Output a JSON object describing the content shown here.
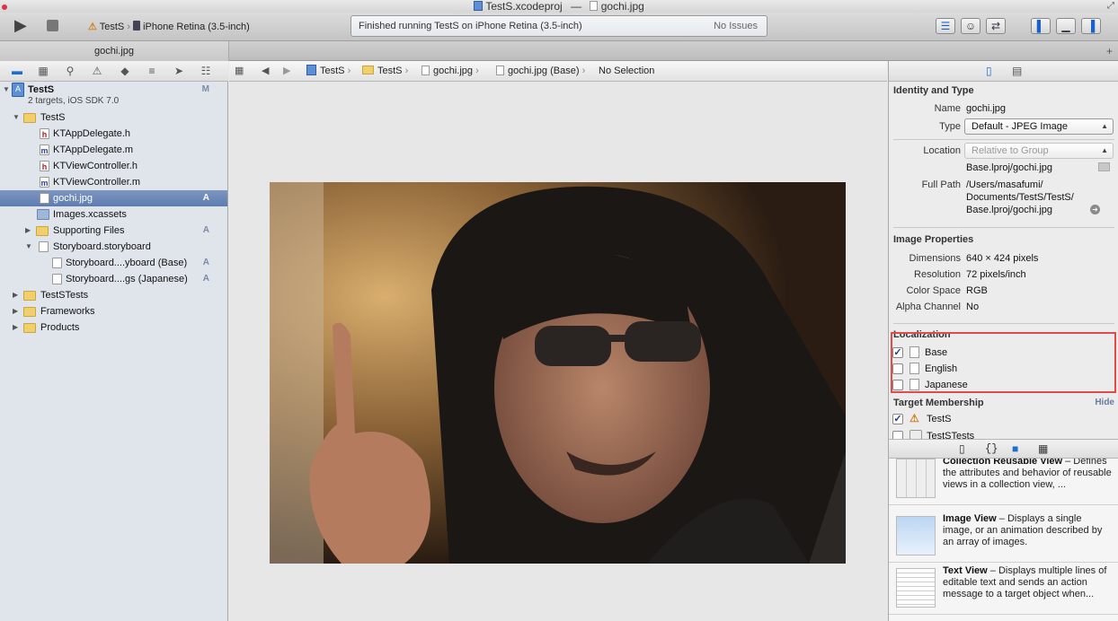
{
  "window": {
    "title_project": "TestS.xcodeproj",
    "title_dash": "—",
    "title_file": "gochi.jpg"
  },
  "toolbar": {
    "scheme": "TestS",
    "destination": "iPhone Retina (3.5-inch)",
    "activity_text": "Finished running TestS on iPhone Retina (3.5-inch)",
    "issues_text": "No Issues"
  },
  "tab": {
    "label": "gochi.jpg"
  },
  "navigator": {
    "project_name": "TestS",
    "project_subtitle": "2 targets, iOS SDK 7.0",
    "project_badge": "M",
    "items": [
      {
        "label": "TestS",
        "badge": ""
      },
      {
        "label": "KTAppDelegate.h",
        "badge": ""
      },
      {
        "label": "KTAppDelegate.m",
        "badge": ""
      },
      {
        "label": "KTViewController.h",
        "badge": ""
      },
      {
        "label": "KTViewController.m",
        "badge": ""
      },
      {
        "label": "gochi.jpg",
        "badge": "A"
      },
      {
        "label": "Images.xcassets",
        "badge": ""
      },
      {
        "label": "Supporting Files",
        "badge": "A"
      },
      {
        "label": "Storyboard.storyboard",
        "badge": ""
      },
      {
        "label": "Storyboard....yboard (Base)",
        "badge": "A"
      },
      {
        "label": "Storyboard....gs (Japanese)",
        "badge": "A"
      },
      {
        "label": "TestSTests",
        "badge": ""
      },
      {
        "label": "Frameworks",
        "badge": ""
      },
      {
        "label": "Products",
        "badge": ""
      }
    ],
    "icons": [
      "file-h-icon",
      "file-m-icon",
      "folder-icon",
      "jpg-icon",
      "assets-icon",
      "storyboard-icon"
    ]
  },
  "jumpbar": {
    "crumbs": [
      "TestS",
      "TestS",
      "gochi.jpg",
      "gochi.jpg (Base)",
      "No Selection"
    ]
  },
  "inspector": {
    "identity_title": "Identity and Type",
    "name_label": "Name",
    "name_value": "gochi.jpg",
    "type_label": "Type",
    "type_value": "Default - JPEG Image",
    "location_label": "Location",
    "location_value": "Relative to Group",
    "location_path": "Base.lproj/gochi.jpg",
    "fullpath_label": "Full Path",
    "fullpath_line1": "/Users/masafumi/",
    "fullpath_line2": "Documents/TestS/TestS/",
    "fullpath_line3": "Base.lproj/gochi.jpg",
    "image_props_title": "Image Properties",
    "dimensions_label": "Dimensions",
    "dimensions_value": "640 × 424 pixels",
    "resolution_label": "Resolution",
    "resolution_value": "72 pixels/inch",
    "colorspace_label": "Color Space",
    "colorspace_value": "RGB",
    "alpha_label": "Alpha Channel",
    "alpha_value": "No",
    "localization_title": "Localization",
    "localizations": [
      {
        "label": "Base",
        "checked": true
      },
      {
        "label": "English",
        "checked": false
      },
      {
        "label": "Japanese",
        "checked": false
      }
    ],
    "target_title": "Target Membership",
    "hide_label": "Hide",
    "targets": [
      {
        "label": "TestS",
        "checked": true
      },
      {
        "label": "TestSTests",
        "checked": false
      }
    ],
    "highlight_color": "#e04c4c"
  },
  "library": {
    "items": [
      {
        "title": "Collection Reusable View",
        "desc": "Defines the attributes and behavior of reusable views in a collection view, ..."
      },
      {
        "title": "Image View",
        "desc": "Displays a single image, or an animation described by an array of images."
      },
      {
        "title": "Text View",
        "desc": "Displays multiple lines of editable text and sends an action message to a target object when..."
      }
    ],
    "title_sep": " – "
  },
  "colors": {
    "selection": "#6d89b8",
    "accent": "#1a6fd0",
    "sidebar_bg": "#e0e5ec"
  }
}
